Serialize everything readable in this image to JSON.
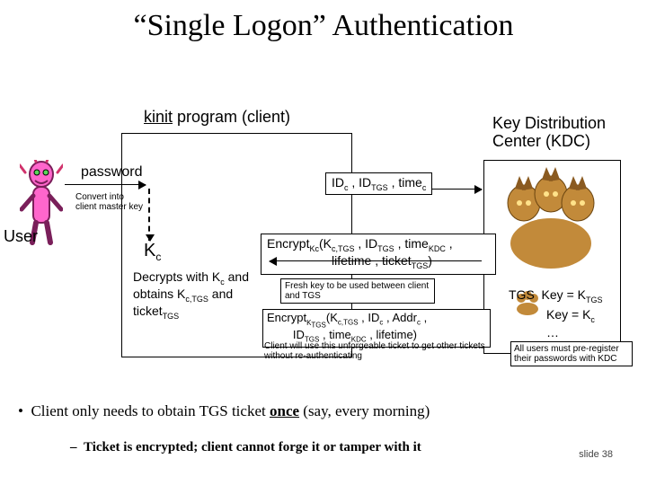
{
  "title": "“Single Logon” Authentication",
  "kinit": {
    "underlined": "kinit",
    "rest": " program (client)"
  },
  "kdc_label": "Key Distribution Center (KDC)",
  "password_label": "password",
  "convert_label": "Convert into\nclient master key",
  "user_label": "User",
  "kc_html": "K<sub>c</sub>",
  "decrypt_html": "Decrypts with K<sub>c</sub> and obtains K<sub>c,TGS</sub> and ticket<sub>TGS</sub>",
  "request_html": "ID<sub>c</sub> , ID<sub>TGS</sub> , time<sub>c</sub>",
  "response_html": "Encrypt<sub>Kc</sub>(K<sub>c,TGS</sub> , ID<sub>TGS</sub> , time<sub>KDC</sub> ,<br><span class=\"indent2\">lifetime , ticket<sub>TGS</sub>)</span>",
  "fresh_text": "Fresh key to be used between client and TGS",
  "ticket_html": "Encrypt<sub>K<sub>TGS</sub></sub>(K<sub>c,TGS</sub> , ID<sub>c</sub> , Addr<sub>c</sub> ,<br>&nbsp;&nbsp;&nbsp;&nbsp;&nbsp;&nbsp;&nbsp;&nbsp;ID<sub>TGS</sub> , time<sub>KDC</sub> , lifetime)",
  "ticket_note": "Client will use this unforgeable ticket to get other tickets without re-authenticating",
  "tgs_key_html": "TGS&nbsp;&nbsp;Key = K<sub>TGS</sub>",
  "kc_key_html": "Key = K<sub>c</sub>",
  "ellipsis": "…",
  "prereg_text": "All users must pre-register their passwords with KDC",
  "bullet1": {
    "pre": "Client only needs to obtain TGS ticket ",
    "once": "once",
    "post": " (say, every morning)"
  },
  "bullet2": "Ticket is encrypted; client cannot forge it or tamper with it",
  "slide_number": "slide 38"
}
